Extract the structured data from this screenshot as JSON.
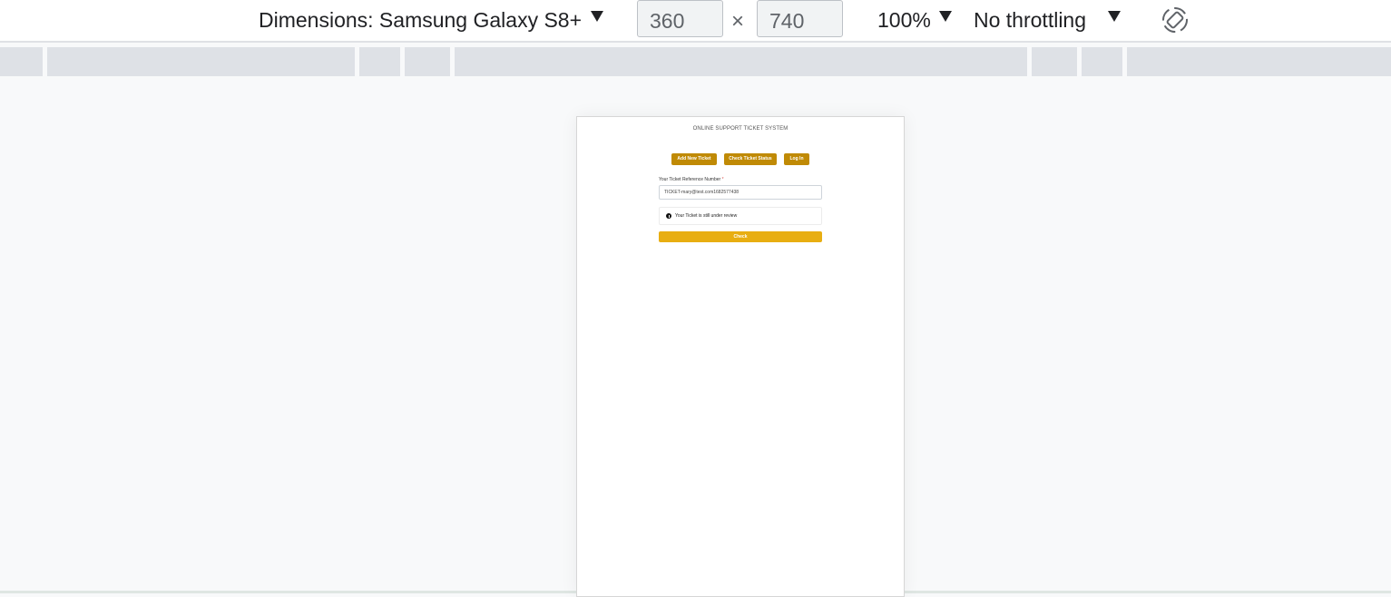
{
  "devtools": {
    "dimensions_label": "Dimensions: Samsung Galaxy S8+",
    "width_value": "360",
    "times_symbol": "×",
    "height_value": "740",
    "zoom_label": "100%",
    "throttling_label": "No throttling",
    "rotate_icon": "rotate-device-icon"
  },
  "app": {
    "title": "ONLINE SUPPORT TICKET SYSTEM",
    "nav": {
      "add_ticket": "Add New Ticket",
      "check_status": "Check Ticket Status",
      "login": "Log In"
    },
    "form": {
      "reference_label": "Your Ticket Reference Number",
      "required_marker": "*",
      "reference_value": "TICKET-mary@test.com1682577438",
      "status_message": "Your Ticket is still under review",
      "check_button": "Check"
    }
  },
  "colors": {
    "nav_button": "#c08a05",
    "check_button": "#e8ae12",
    "ruler": "#dee1e6"
  }
}
